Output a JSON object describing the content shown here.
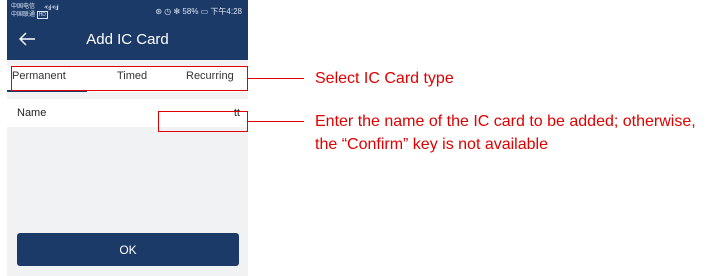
{
  "status_bar": {
    "carrier1": "中国电信",
    "carrier2": "中国联通",
    "hd": "HD",
    "signal": "⁴⁶.ıl ⁴⁶.ıl",
    "right": "⊛ ◷ ✻ 58% ▭ 下午4:28"
  },
  "header": {
    "title": "Add IC Card"
  },
  "tabs": [
    {
      "label": "Permanent",
      "selected": true
    },
    {
      "label": "Timed",
      "selected": false
    },
    {
      "label": "Recurring",
      "selected": false
    }
  ],
  "form": {
    "name_label": "Name",
    "name_value": "tt"
  },
  "ok_label": "OK",
  "annotations": {
    "select_type": "Select IC Card type",
    "enter_name_line1": "Enter the name of the IC card to be added; otherwise,",
    "enter_name_line2": "the “Confirm” key is not available"
  },
  "colors": {
    "primary": "#1c3a68",
    "annotation": "#e00000",
    "background": "#f1f2f4"
  }
}
